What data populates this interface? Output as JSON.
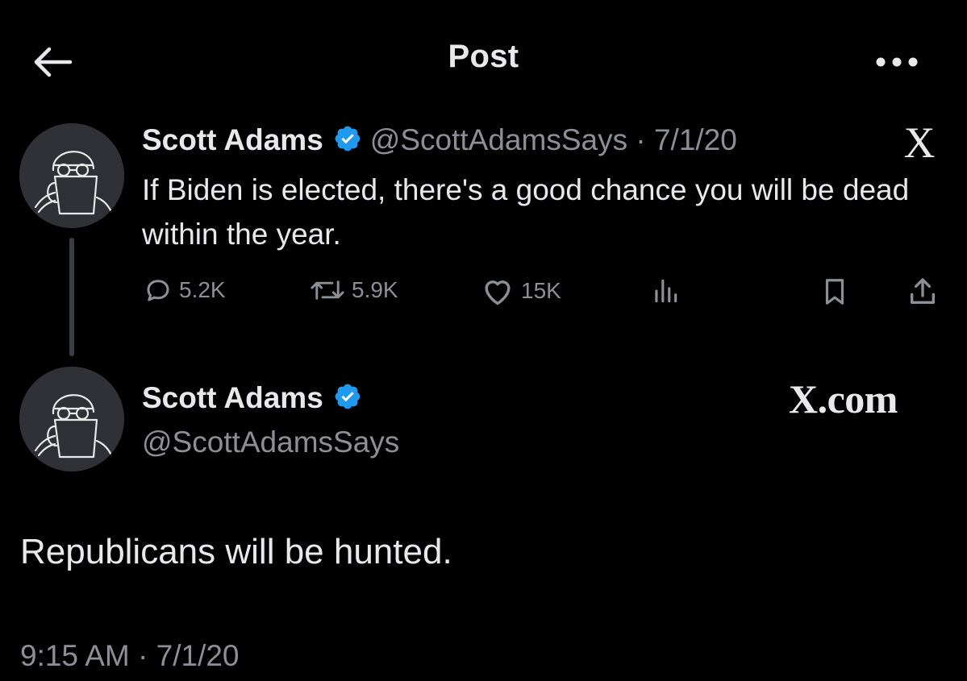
{
  "header": {
    "title": "Post",
    "back_icon": "arrow-left-icon",
    "more_icon": "more-dots-icon"
  },
  "quoted_tweet": {
    "author_name": "Scott Adams",
    "handle_and_date": "@ScottAdamsSays · 7/1/20",
    "text": "If Biden is elected, there's a good chance you will be dead within the year.",
    "replies": "5.2K",
    "reposts": "5.9K",
    "likes": "15K",
    "x_logo": "X"
  },
  "main_tweet": {
    "author_name": "Scott Adams",
    "handle": "@ScottAdamsSays",
    "brand": "X.com",
    "text": "Republicans will be hunted.",
    "timestamp": "9:15 AM · 7/1/20"
  },
  "colors": {
    "background": "#000000",
    "text": "#e7e9ea",
    "muted": "#8b9096",
    "verified": "#1d9bf0"
  }
}
